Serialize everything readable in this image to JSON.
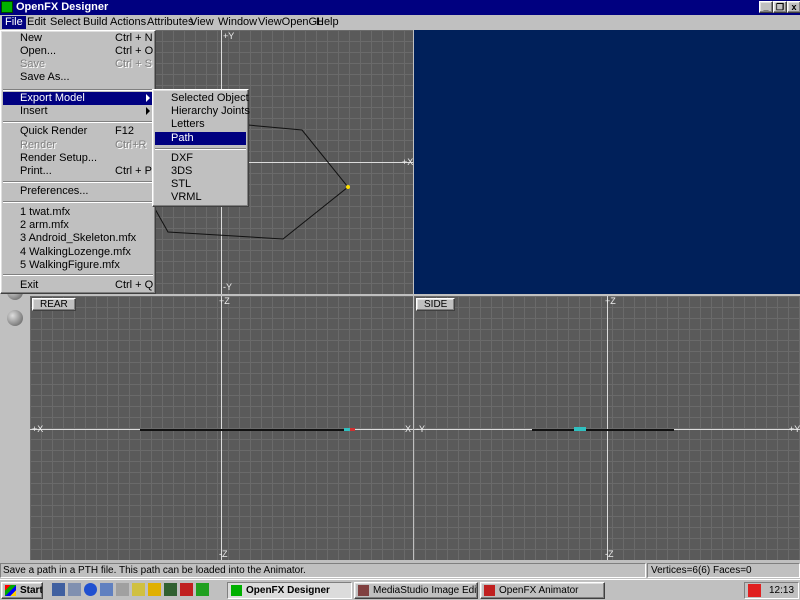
{
  "window": {
    "title": "OpenFX Designer"
  },
  "menubar": [
    "File",
    "Edit",
    "Select",
    "Build",
    "Actions",
    "Attributes",
    "View",
    "Window",
    "ViewOpenGL",
    "Help"
  ],
  "file_menu": {
    "new": "New",
    "new_key": "Ctrl + N",
    "open": "Open...",
    "open_key": "Ctrl + O",
    "save": "Save",
    "save_key": "Ctrl + S",
    "save_as": "Save As...",
    "export": "Export Model",
    "insert": "Insert",
    "quick_render": "Quick Render",
    "quick_render_key": "F12",
    "render": "Render",
    "render_key": "Ctrl+R",
    "render_setup": "Render Setup...",
    "print": "Print...",
    "print_key": "Ctrl + P",
    "preferences": "Preferences...",
    "recent": [
      "1 twat.mfx",
      "2 arm.mfx",
      "3 Android_Skeleton.mfx",
      "4 WalkingLozenge.mfx",
      "5 WalkingFigure.mfx"
    ],
    "exit": "Exit",
    "exit_key": "Ctrl + Q"
  },
  "export_menu": {
    "items": [
      "Selected Object",
      "Hierarchy Joints",
      "Letters",
      "Path"
    ],
    "formats": [
      "DXF",
      "3DS",
      "STL",
      "VRML"
    ]
  },
  "viewports": {
    "front": {
      "axis_top": "+Y",
      "axis_bottom": "-Y",
      "axis_right": "+X"
    },
    "rear": {
      "label": "REAR",
      "axis_top": "+Z",
      "axis_bottom": "-Z",
      "axis_left": "+X",
      "axis_right": "-X"
    },
    "side": {
      "label": "SIDE",
      "axis_top": "+Z",
      "axis_bottom": "-Z",
      "axis_left": "-Y",
      "axis_right": "+Y"
    }
  },
  "status": {
    "message": "Save a path in a PTH file. This path can be loaded into the Animator.",
    "stats": "Vertices=6(6) Faces=0"
  },
  "taskbar": {
    "start": "Start",
    "tasks": [
      "OpenFX Designer",
      "MediaStudio Image Editor",
      "OpenFX Animator"
    ],
    "clock": "12:13"
  },
  "colors": {
    "title_bar": "#000080",
    "viewport_bg": "#5a5a5a",
    "perspective_bg": "#00205a",
    "selection": "#000080"
  }
}
